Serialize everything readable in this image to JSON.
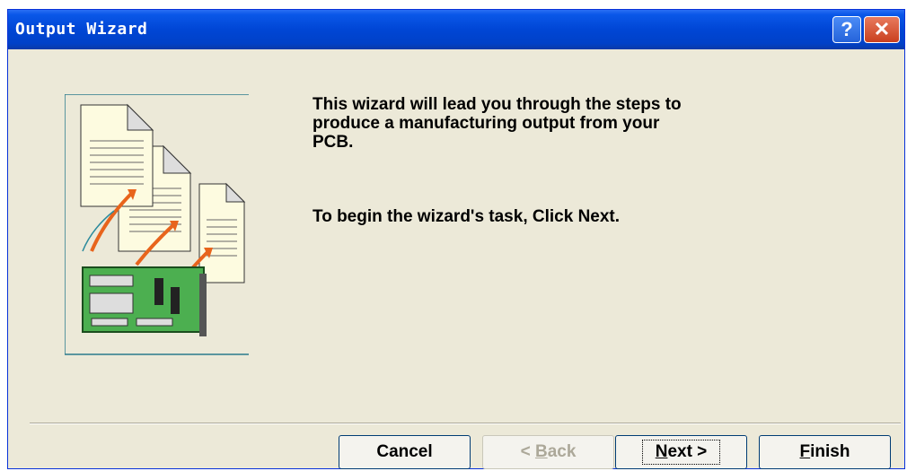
{
  "window": {
    "title": "Output Wizard"
  },
  "titlebar": {
    "help_label": "?",
    "close_label": "✕"
  },
  "content": {
    "message_1": "This wizard will lead you through the steps to\nproduce a manufacturing output from your\nPCB.",
    "message_2": "To begin the wizard's task, Click Next."
  },
  "buttons": {
    "cancel": "Cancel",
    "back_arrow": "< ",
    "back_key": "B",
    "back_rest": "ack",
    "next_key": "N",
    "next_rest": "ext >",
    "finish_key": "F",
    "finish_rest": "inish"
  },
  "colors": {
    "titlebar": "#0046d5",
    "window_bg": "#ece9d8",
    "pcb_green": "#4caf50",
    "arrow_orange": "#e8641c"
  }
}
